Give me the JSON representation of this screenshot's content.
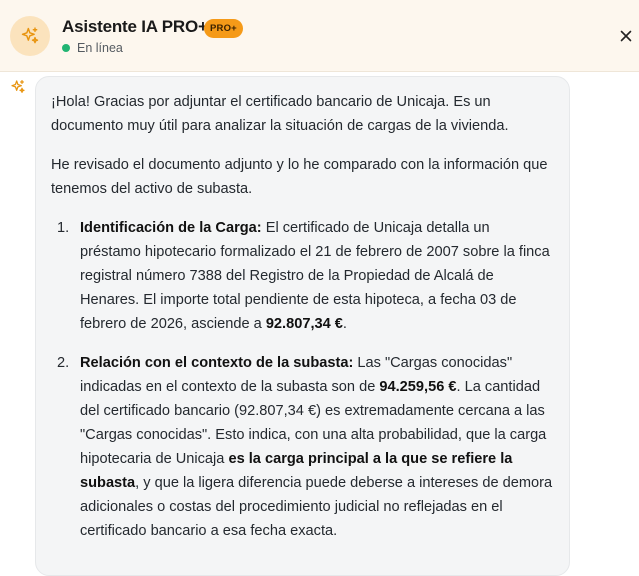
{
  "header": {
    "title": "Asistente IA PRO+",
    "badge": "PRO+",
    "status": "En línea"
  },
  "message": {
    "intro": "¡Hola! Gracias por adjuntar el certificado bancario de Unicaja. Es un documento muy útil para analizar la situación de cargas de la vivienda.",
    "review": "He revisado el documento adjunto y lo he comparado con la información que tenemos del activo de subasta.",
    "items": [
      {
        "num": "1.",
        "heading": "Identificación de la Carga:",
        "text1": " El certificado de Unicaja detalla un préstamo hipotecario formalizado el 21 de febrero de 2007 sobre la finca registral número 7388 del Registro de la Propiedad de Alcalá de Henares. El importe total pendiente de esta hipoteca, a fecha 03 de febrero de 2026, asciende a ",
        "amount": "92.807,34 €",
        "text2": "."
      },
      {
        "num": "2.",
        "heading": "Relación con el contexto de la subasta:",
        "text1": " Las \"Cargas conocidas\" indicadas en el contexto de la subasta son de ",
        "amount": "94.259,56 €",
        "text2": ". La cantidad del certificado bancario (92.807,34 €) es extremadamente cercana a las \"Cargas conocidas\". Esto indica, con una alta probabilidad, que la carga hipotecaria de Unicaja ",
        "emphasis": "es la carga principal a la que se refiere la subasta",
        "text3": ", y que la ligera diferencia puede deberse a intereses de demora adicionales o costas del procedimiento judicial no reflejadas en el certificado bancario a esa fecha exacta."
      }
    ]
  },
  "colors": {
    "header_bg": "#fdf7ee",
    "badge": "#f59a18",
    "status_dot": "#22b573",
    "bubble_bg": "#f4f5f6"
  },
  "icons": {
    "avatar": "sparkles-icon",
    "close": "close-icon",
    "bot": "sparkles-icon"
  }
}
